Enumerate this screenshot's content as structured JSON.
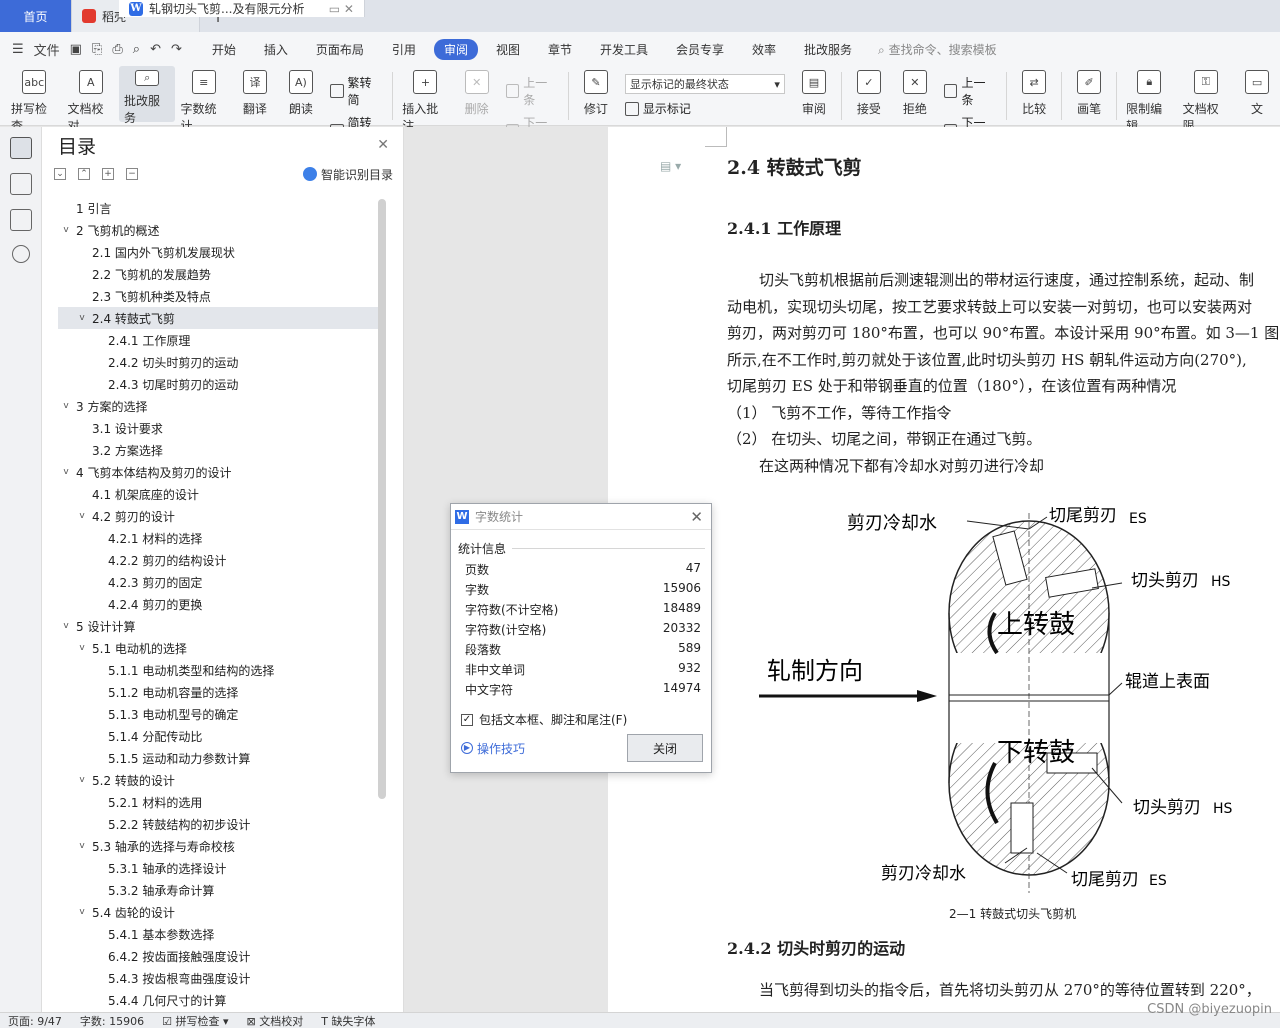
{
  "tabs": {
    "home": "首页",
    "app": "稻壳",
    "doc": "轧钢切头飞剪...及有限元分析",
    "doc_ctrl": "▭ ✕",
    "plus": "+"
  },
  "menubar": {
    "file": "文件",
    "items": [
      "开始",
      "插入",
      "页面布局",
      "引用",
      "审阅",
      "视图",
      "章节",
      "开发工具",
      "会员专享",
      "效率",
      "批改服务"
    ],
    "active": "审阅",
    "search": "查找命令、搜索模板"
  },
  "ribbon": {
    "spell": "拼写检查",
    "doc_check": "文档校对",
    "correct": "批改服务",
    "word_count": "字数统计",
    "translate": "翻译",
    "read": "朗读",
    "trad": "繁转简",
    "simp": "简转繁",
    "insert_comment": "插入批注",
    "delete": "删除",
    "prev": "上一条",
    "next": "下一条",
    "revise": "修订",
    "markup_state": "显示标记的最终状态",
    "show_markup": "显示标记",
    "review": "审阅",
    "accept": "接受",
    "reject": "拒绝",
    "prev2": "上一条",
    "next2": "下一条",
    "compare": "比较",
    "pen": "画笔",
    "restrict": "限制编辑",
    "doc_perm": "文档权限",
    "doc_more": "文"
  },
  "toc": {
    "title": "目录",
    "smart": "智能识别目录",
    "items": [
      {
        "level": 0,
        "chev": "",
        "text": "1 引言"
      },
      {
        "level": 0,
        "chev": "v",
        "text": "2 飞剪机的概述"
      },
      {
        "level": 1,
        "chev": "",
        "text": "2.1 国内外飞剪机发展现状"
      },
      {
        "level": 1,
        "chev": "",
        "text": "2.2 飞剪机的发展趋势"
      },
      {
        "level": 1,
        "chev": "",
        "text": "2.3 飞剪机种类及特点"
      },
      {
        "level": 1,
        "chev": "v",
        "text": "2.4  转鼓式飞剪",
        "selected": true
      },
      {
        "level": 2,
        "chev": "",
        "text": "2.4.1 工作原理"
      },
      {
        "level": 2,
        "chev": "",
        "text": "2.4.2  切头时剪刃的运动"
      },
      {
        "level": 2,
        "chev": "",
        "text": "2.4.3  切尾时剪刃的运动"
      },
      {
        "level": 0,
        "chev": "v",
        "text": "3  方案的选择"
      },
      {
        "level": 1,
        "chev": "",
        "text": "3.1  设计要求"
      },
      {
        "level": 1,
        "chev": "",
        "text": "3.2  方案选择"
      },
      {
        "level": 0,
        "chev": "v",
        "text": "4 飞剪本体结构及剪刃的设计"
      },
      {
        "level": 1,
        "chev": "",
        "text": "4.1 机架底座的设计"
      },
      {
        "level": 1,
        "chev": "v",
        "text": "4.2 剪刃的设计"
      },
      {
        "level": 2,
        "chev": "",
        "text": "4.2.1 材料的选择"
      },
      {
        "level": 2,
        "chev": "",
        "text": "4.2.2 剪刃的结构设计"
      },
      {
        "level": 2,
        "chev": "",
        "text": "4.2.3 剪刃的固定"
      },
      {
        "level": 2,
        "chev": "",
        "text": "4.2.4  剪刃的更换"
      },
      {
        "level": 0,
        "chev": "v",
        "text": "5  设计计算"
      },
      {
        "level": 1,
        "chev": "v",
        "text": "5.1 电动机的选择"
      },
      {
        "level": 2,
        "chev": "",
        "text": "5.1.1 电动机类型和结构的选择"
      },
      {
        "level": 2,
        "chev": "",
        "text": "5.1.2  电动机容量的选择"
      },
      {
        "level": 2,
        "chev": "",
        "text": "5.1.3  电动机型号的确定"
      },
      {
        "level": 2,
        "chev": "",
        "text": "5.1.4  分配传动比"
      },
      {
        "level": 2,
        "chev": "",
        "text": "5.1.5  运动和动力参数计算"
      },
      {
        "level": 1,
        "chev": "v",
        "text": "5.2  转鼓的设计"
      },
      {
        "level": 2,
        "chev": "",
        "text": "5.2.1  材料的选用"
      },
      {
        "level": 2,
        "chev": "",
        "text": "5.2.2  转鼓结构的初步设计"
      },
      {
        "level": 1,
        "chev": "v",
        "text": "5.3 轴承的选择与寿命校核"
      },
      {
        "level": 2,
        "chev": "",
        "text": "5.3.1  轴承的选择设计"
      },
      {
        "level": 2,
        "chev": "",
        "text": "5.3.2  轴承寿命计算"
      },
      {
        "level": 1,
        "chev": "v",
        "text": "5.4  齿轮的设计"
      },
      {
        "level": 2,
        "chev": "",
        "text": "5.4.1  基本参数选择"
      },
      {
        "level": 2,
        "chev": "",
        "text": "6.4.2  按齿面接触强度设计"
      },
      {
        "level": 2,
        "chev": "",
        "text": "5.4.3 按齿根弯曲强度设计"
      },
      {
        "level": 2,
        "chev": "",
        "text": "5.4.4  几何尺寸的计算"
      }
    ]
  },
  "doc": {
    "h2": "2.4  转鼓式飞剪",
    "h3a": "2.4.1 工作原理",
    "lines": [
      {
        "indent": true,
        "text": "切头飞剪机根据前后测速辊测出的带材运行速度，通过控制系统，起动、制"
      },
      {
        "indent": false,
        "text": "动电机，实现切头切尾，按工艺要求转鼓上可以安装一对剪切，也可以安装两对"
      },
      {
        "indent": false,
        "text": "剪刃，两对剪刃可 180°布置，也可以 90°布置。本设计采用 90°布置。如 3—1 图"
      },
      {
        "indent": false,
        "text": "所示,在不工作时,剪刃就处于该位置,此时切头剪刃 HS 朝轧件运动方向(270°),"
      },
      {
        "indent": false,
        "text": "切尾剪刃 ES 处于和带钢垂直的位置（180°），在该位置有两种情况"
      },
      {
        "indent": false,
        "text": "（1）  飞剪不工作，等待工作指令"
      },
      {
        "indent": false,
        "text": "（2）  在切头、切尾之间，带钢正在通过飞剪。"
      },
      {
        "indent": true,
        "text": "      在这两种情况下都有冷却水对剪刃进行冷却"
      }
    ],
    "fig_labels": {
      "coolant_top": "剪刃冷却水",
      "tail_top": "切尾剪刃",
      "es": "ES",
      "head_top": "切头剪刃",
      "hs": "HS",
      "upper_drum": "上转鼓",
      "rolling_dir": "轧制方向",
      "roller_surface": "辊道上表面",
      "lower_drum": "下转鼓",
      "head_bottom": "切头剪刃",
      "coolant_bottom": "剪刃冷却水",
      "tail_bottom": "切尾剪刃"
    },
    "caption": "2—1  转鼓式切头飞剪机",
    "h3b": "2.4.2  切头时剪刃的运动",
    "para2": "当飞剪得到切头的指令后，首先将切头剪刃从 270°的等待位置转到 220°，"
  },
  "dialog": {
    "title": "字数统计",
    "section": "统计信息",
    "stats": [
      {
        "label": "页数",
        "value": "47"
      },
      {
        "label": "字数",
        "value": "15906"
      },
      {
        "label": "字符数(不计空格)",
        "value": "18489"
      },
      {
        "label": "字符数(计空格)",
        "value": "20332"
      },
      {
        "label": "段落数",
        "value": "589"
      },
      {
        "label": "非中文单词",
        "value": "932"
      },
      {
        "label": "中文字符",
        "value": "14974"
      }
    ],
    "checkbox": "包括文本框、脚注和尾注(F)",
    "tips": "操作技巧",
    "close": "关闭"
  },
  "status": {
    "page": "页面: 9/47",
    "words": "字数: 15906",
    "spell": "拼写检查",
    "doc_check": "文档校对",
    "font": "缺失字体"
  },
  "watermark": "CSDN @biyezuopin"
}
